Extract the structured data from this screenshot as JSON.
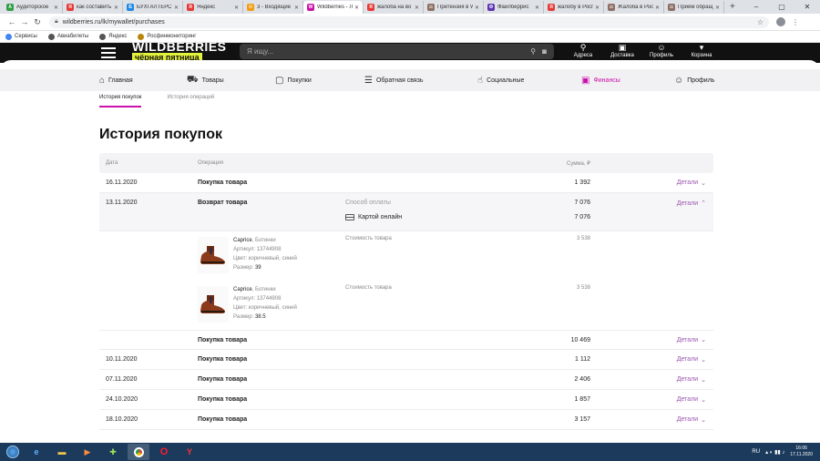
{
  "browser": {
    "tabs": [
      {
        "label": "Аудиторское",
        "color": "#2e9e45",
        "glyph": "A"
      },
      {
        "label": "как составить",
        "color": "#e53935",
        "glyph": "Я"
      },
      {
        "label": "БУХГАЛТЕРСК",
        "color": "#1e88e5",
        "glyph": "Б"
      },
      {
        "label": "Яндекс",
        "color": "#e53935",
        "glyph": "Я"
      },
      {
        "label": "3 - Входящие",
        "color": "#f39c12",
        "glyph": "✉"
      },
      {
        "label": "Wildberries - Л",
        "color": "#cb11ab",
        "glyph": "W",
        "active": true
      },
      {
        "label": "жалоба на во",
        "color": "#e53935",
        "glyph": "Я"
      },
      {
        "label": "Претензия в W",
        "color": "#8d6e63",
        "glyph": "⚖"
      },
      {
        "label": "Файлберрис",
        "color": "#5e35b1",
        "glyph": "Ф"
      },
      {
        "label": "жалобу в Росп",
        "color": "#e53935",
        "glyph": "Я"
      },
      {
        "label": "Жалоба в Росп",
        "color": "#8d6e63",
        "glyph": "⚖"
      },
      {
        "label": "Приём обращ",
        "color": "#8d6e63",
        "glyph": "⚖"
      }
    ],
    "url": "wildberries.ru/lk/mywallet/purchases",
    "bookmarks": [
      {
        "label": "Сервисы",
        "color": "#4285f4"
      },
      {
        "label": "Авиабилеты",
        "color": "#555555"
      },
      {
        "label": "Яндекс",
        "color": "#555555"
      },
      {
        "label": "Росфинмониторинг",
        "color": "#b8860b"
      }
    ]
  },
  "header": {
    "logo": "WILDBERRIES",
    "logo_sub": "чёрная пятница",
    "search_placeholder": "Я ищу...",
    "icons": [
      {
        "label": "Адреса",
        "glyph": "⚲"
      },
      {
        "label": "Доставка",
        "glyph": "▣"
      },
      {
        "label": "Профиль",
        "glyph": "☺"
      },
      {
        "label": "Корзина",
        "glyph": "▾"
      }
    ]
  },
  "nav": {
    "items": [
      {
        "label": "Главная",
        "glyph": "⌂"
      },
      {
        "label": "Товары",
        "glyph": "⛟"
      },
      {
        "label": "Покупки",
        "glyph": "▢"
      },
      {
        "label": "Обратная связь",
        "glyph": "☰"
      },
      {
        "label": "Социальные",
        "glyph": "☝"
      },
      {
        "label": "Финансы",
        "glyph": "▣",
        "active": true
      },
      {
        "label": "Профиль",
        "glyph": "☺"
      }
    ]
  },
  "subtabs": [
    "История покупок",
    "История операций"
  ],
  "page_title": "История покупок",
  "table": {
    "headers": {
      "date": "Дата",
      "operation": "Операция",
      "sum": "Сумма, ₽"
    },
    "details_label": "Детали",
    "rows_top": [
      {
        "date": "16.11.2020",
        "operation": "Покупка товара",
        "sum": "1 392"
      }
    ],
    "expanded": {
      "date": "13.11.2020",
      "operation": "Возврат товара",
      "sum": "7 076",
      "pay_label": "Способ оплаты",
      "pay_method": "Картой онлайн",
      "pay_sum": "7 076",
      "items": [
        {
          "brand": "Caprice",
          "name": "Ботинки",
          "article_label": "Артикул:",
          "article": "13744908",
          "color_label": "Цвет:",
          "color": "коричневый, синий",
          "size_label": "Размер:",
          "size": "39",
          "price_label": "Стоимость товара",
          "price": "3 538"
        },
        {
          "brand": "Caprice",
          "name": "Ботинки",
          "article_label": "Артикул:",
          "article": "13744908",
          "color_label": "Цвет:",
          "color": "коричневый, синий",
          "size_label": "Размер:",
          "size": "38.5",
          "price_label": "Стоимость товара",
          "price": "3 538"
        }
      ],
      "sub_row": {
        "operation": "Покупка товара",
        "sum": "10 469"
      }
    },
    "rows_bottom": [
      {
        "date": "10.11.2020",
        "operation": "Покупка товара",
        "sum": "1 112"
      },
      {
        "date": "07.11.2020",
        "operation": "Покупка товара",
        "sum": "2 406"
      },
      {
        "date": "24.10.2020",
        "operation": "Покупка товара",
        "sum": "1 857"
      },
      {
        "date": "18.10.2020",
        "operation": "Покупка товара",
        "sum": "3 157"
      }
    ]
  },
  "taskbar": {
    "lang": "RU",
    "time": "16:06",
    "date": "17.11.2020"
  },
  "colors": {
    "accent": "#cb11ab",
    "details": "#9b57b0"
  }
}
